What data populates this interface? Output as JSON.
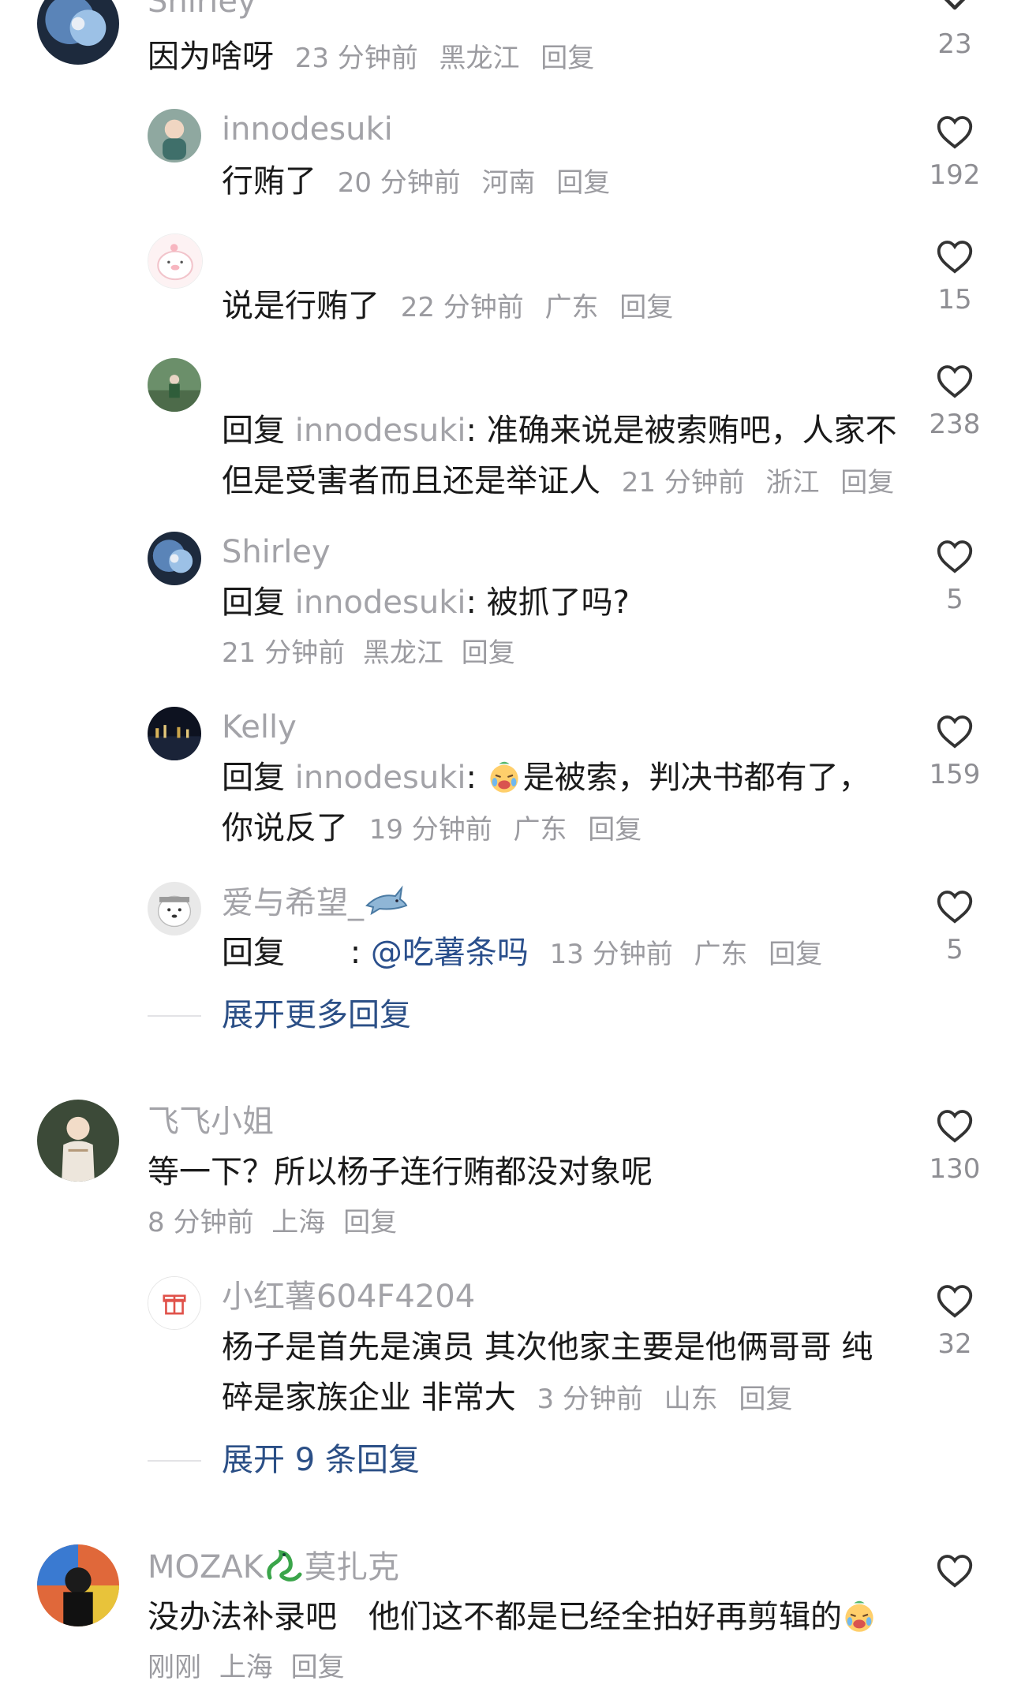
{
  "top_comment": {
    "name_partial": "Shirley",
    "text": "因为啥呀",
    "time": "23 分钟前",
    "location": "黑龙江",
    "reply": "回复",
    "likes": "23"
  },
  "replies_1": [
    {
      "name": "innodesuki",
      "text": "行贿了",
      "time": "20 分钟前",
      "location": "河南",
      "reply": "回复",
      "likes": "192"
    },
    {
      "name": "",
      "text": "说是行贿了",
      "time": "22 分钟前",
      "location": "广东",
      "reply": "回复",
      "likes": "15"
    },
    {
      "name": "",
      "reply_prefix": "回复",
      "mention": "innodesuki",
      "text_line1": "准确来说是被索贿吧，人家不",
      "text_line2": "但是受害者而且还是举证人",
      "time": "21 分钟前",
      "location": "浙江",
      "reply": "回复",
      "likes": "238"
    },
    {
      "name": "Shirley",
      "reply_prefix": "回复",
      "mention": "innodesuki",
      "text": "被抓了吗?",
      "time": "21 分钟前",
      "location": "黑龙江",
      "reply": "回复",
      "likes": "5"
    },
    {
      "name": "Kelly",
      "reply_prefix": "回复",
      "mention": "innodesuki",
      "text_line1": "是被索，判决书都有了，",
      "text_line2": "你说反了",
      "time": "19 分钟前",
      "location": "广东",
      "reply": "回复",
      "likes": "159"
    },
    {
      "name": "爱与希望_",
      "reply_prefix": "回复",
      "at_user": "@吃薯条吗",
      "time": "13 分钟前",
      "location": "广东",
      "reply": "回复",
      "likes": "5"
    }
  ],
  "expand_more": "展开更多回复",
  "comment_2": {
    "name": "飞飞小姐",
    "text": "等一下？所以杨子连行贿都没对象呢",
    "time": "8 分钟前",
    "location": "上海",
    "reply": "回复",
    "likes": "130"
  },
  "reply_2": {
    "name": "小红薯604F4204",
    "text_line1": "杨子是首先是演员 其次他家主要是他俩哥哥 纯",
    "text_line2": "碎是家族企业 非常大",
    "time": "3 分钟前",
    "location": "山东",
    "reply": "回复",
    "likes": "32"
  },
  "expand_9": "展开 9 条回复",
  "comment_3": {
    "name": "MOZAK",
    "name_suffix": "莫扎克",
    "text": "没办法补录吧　他们这不都是已经全拍好再剪辑的",
    "time": "刚刚",
    "location": "上海",
    "reply": "回复",
    "likes": ""
  },
  "colors": {
    "username": "#a3a3a8",
    "meta": "#9b9ba0",
    "link": "#2b4f86",
    "text": "#1a1a1a"
  }
}
